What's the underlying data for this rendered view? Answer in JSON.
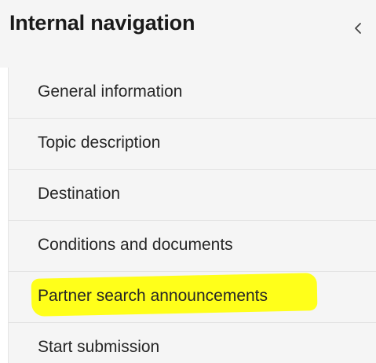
{
  "header": {
    "title": "Internal navigation",
    "collapse_icon": "chevron-left-icon"
  },
  "nav": {
    "items": [
      {
        "label": "General information",
        "highlighted": false
      },
      {
        "label": "Topic description",
        "highlighted": false
      },
      {
        "label": "Destination",
        "highlighted": false
      },
      {
        "label": "Conditions and documents",
        "highlighted": false
      },
      {
        "label": "Partner search announcements",
        "highlighted": true
      },
      {
        "label": "Start submission",
        "highlighted": false
      }
    ]
  },
  "colors": {
    "background": "#f5f5f5",
    "highlight": "#ffff1a",
    "text": "#262626",
    "divider": "#e3e3e3"
  }
}
